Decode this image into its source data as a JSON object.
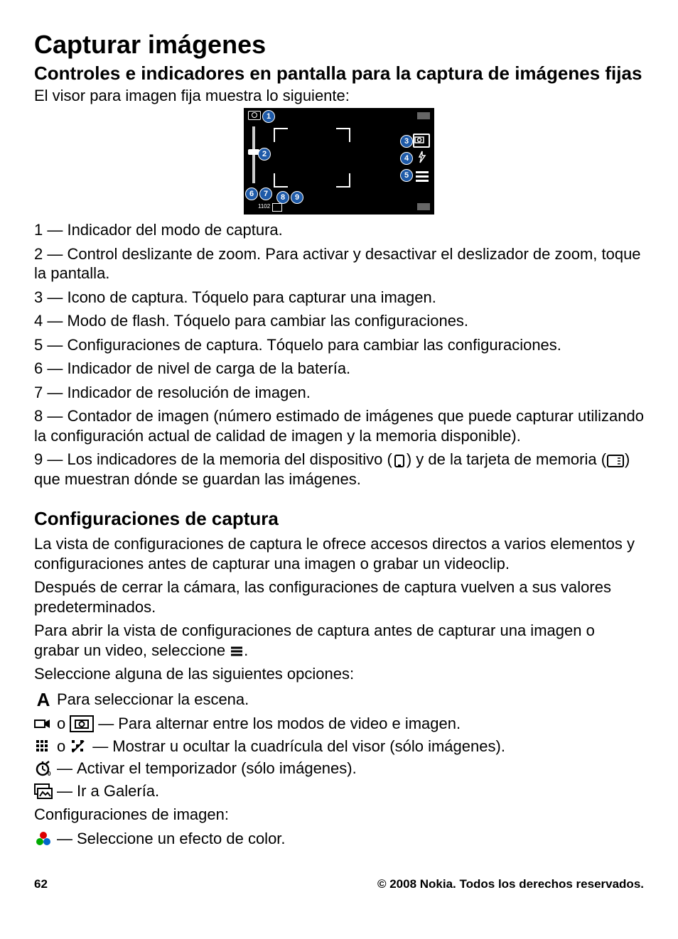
{
  "title": "Capturar imágenes",
  "section1_title": "Controles e indicadores en pantalla para la captura de imágenes fijas",
  "section1_intro": "El visor para imagen fija muestra lo siguiente:",
  "indicators": {
    "i1": "1 — Indicador del modo de captura.",
    "i2": "2 — Control deslizante de zoom. Para activar y desactivar el deslizador de zoom, toque la pantalla.",
    "i3": "3 — Icono de captura. Tóquelo para capturar una imagen.",
    "i4": "4 — Modo de flash. Tóquelo para cambiar las configuraciones.",
    "i5": "5 — Configuraciones de captura. Tóquelo para cambiar las configuraciones.",
    "i6": "6 — Indicador de nivel de carga de la batería.",
    "i7": "7 — Indicador de resolución de imagen.",
    "i8": "8 — Contador de imagen (número estimado de imágenes que puede capturar utilizando la configuración actual de calidad de imagen y la memoria disponible).",
    "i9_a": "9 — Los indicadores de la memoria del dispositivo (",
    "i9_b": ") y de la tarjeta de memoria (",
    "i9_c": ") que muestran dónde se guardan las imágenes."
  },
  "section2_title": "Configuraciones de captura",
  "section2_p1": "La vista de configuraciones de captura le ofrece accesos directos a varios elementos y configuraciones antes de capturar una imagen o grabar un videoclip.",
  "section2_p2": "Después de cerrar la cámara, las configuraciones de captura vuelven a sus valores predeterminados.",
  "section2_p3a": "Para abrir la vista de configuraciones de captura antes de capturar una imagen o grabar un video, seleccione ",
  "section2_p3b": ".",
  "section2_p4": "Seleccione alguna de las siguientes opciones:",
  "opts": {
    "scene": "Para seleccionar la escena.",
    "toggle": "Para alternar entre los modos de video e imagen.",
    "grid": "Mostrar u ocultar la cuadrícula del visor (sólo imágenes).",
    "timer": "Activar el temporizador (sólo imágenes).",
    "gallery": "Ir a Galería."
  },
  "img_cfg_label": "Configuraciones de imagen:",
  "img_cfg_color": "Seleccione un efecto de color.",
  "strings": {
    "or": "o",
    "dash": "—"
  },
  "viewfinder": {
    "nums": [
      "1",
      "2",
      "3",
      "4",
      "5",
      "6",
      "7",
      "8",
      "9"
    ],
    "counter": "1102"
  },
  "footer": {
    "page": "62",
    "copyright": "© 2008 Nokia. Todos los derechos reservados."
  }
}
